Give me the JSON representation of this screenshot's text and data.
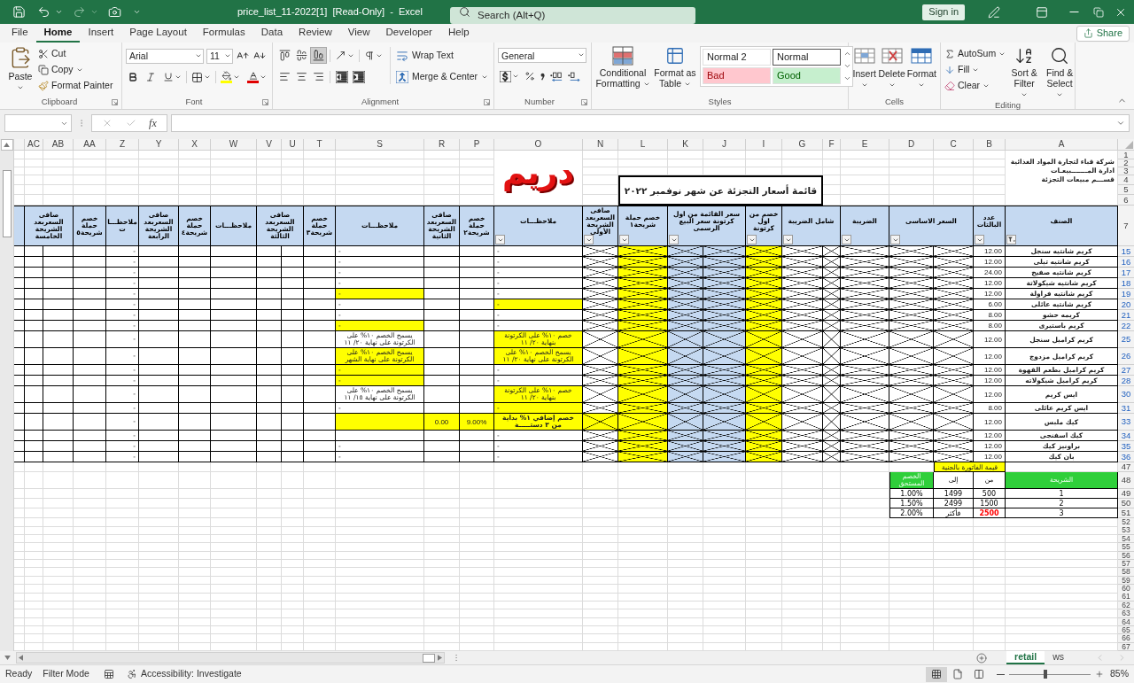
{
  "window": {
    "title": "price_list_11-2022[1]  [Read-Only]  -  Excel",
    "search": {
      "placeholder": "Search (Alt+Q)"
    },
    "sign_in": "Sign in"
  },
  "menu_tabs": [
    {
      "label": "Help",
      "selected": false
    },
    {
      "label": "Developer",
      "selected": false
    },
    {
      "label": "View",
      "selected": false
    },
    {
      "label": "Review",
      "selected": false
    },
    {
      "label": "Data",
      "selected": false
    },
    {
      "label": "Formulas",
      "selected": false
    },
    {
      "label": "Page Layout",
      "selected": false
    },
    {
      "label": "Insert",
      "selected": false
    },
    {
      "label": "Home",
      "selected": true
    },
    {
      "label": "File",
      "selected": false
    }
  ],
  "share": "Share",
  "ribbon": {
    "clipboard": {
      "label": "Clipboard",
      "paste": "Paste",
      "cut": "Cut",
      "copy": "Copy",
      "format_painter": "Format Painter"
    },
    "font": {
      "label": "Font",
      "name": "Arial",
      "size": "11"
    },
    "alignment": {
      "label": "Alignment",
      "vertical_align": [
        {
          "selected": false
        },
        {
          "selected": false
        },
        {
          "selected": true
        }
      ],
      "wrap_text": "Wrap Text",
      "merge_center": "Merge & Center"
    },
    "number": {
      "label": "Number",
      "format": "General"
    },
    "styles": {
      "label": "Styles",
      "conditional_formatting": "Conditional Formatting",
      "format_as_table": "Format as Table",
      "cell_styles": [
        {
          "name": "Normal",
          "kind": "normal",
          "selected": true
        },
        {
          "name": "Normal 2",
          "kind": "normal",
          "selected": false
        },
        {
          "name": "Good",
          "kind": "good",
          "selected": false
        },
        {
          "name": "Bad",
          "kind": "bad",
          "selected": false
        }
      ]
    },
    "cells": {
      "label": "Cells",
      "insert": "Insert",
      "delete": "Delete",
      "format": "Format"
    },
    "editing": {
      "label": "Editing",
      "autosum": "AutoSum",
      "fill": "Fill",
      "clear": "Clear",
      "sort_filter": "Sort & Filter",
      "find_select": "Find & Select"
    }
  },
  "formula_bar": {
    "function_label": "fx"
  },
  "sheet": {
    "column_letters": [
      "A",
      "B",
      "C",
      "D",
      "E",
      "F",
      "G",
      "I",
      "J",
      "K",
      "L",
      "N",
      "O",
      "P",
      "R",
      "S",
      "T",
      "U",
      "V",
      "W",
      "X",
      "Y",
      "Z",
      "AA",
      "AB",
      "AC"
    ],
    "top_row_numbers": [
      "1",
      "2",
      "3",
      "4",
      "5",
      "6"
    ],
    "company_lines": [
      "شركة قباء لتجارة المواد الغذائية",
      "ادارة المـــــــبيعـات",
      "قســـم مبيعات التجزئة"
    ],
    "logo": "دريم",
    "title": "قائمة أسعار التجزئة عن شهر نوفمبر ٢٠٢٢",
    "header": {
      "row_number": "7",
      "cells": [
        {
          "text": "الصنف",
          "merged": false,
          "filter": true,
          "filtered": true
        },
        {
          "text": "عدد البالتات",
          "merged": false,
          "filter": true,
          "filtered": false
        },
        {
          "text": "السعر الاساسى",
          "merged": true,
          "filter": true,
          "filtered": false
        },
        {
          "text": "الضريبة",
          "merged": false,
          "filter": true,
          "filtered": false
        },
        {
          "text": "شامل الضريبة",
          "merged": true,
          "filter": true,
          "filtered": false
        },
        {
          "text": "خصم من اول كرتونة",
          "merged": false,
          "filter": true,
          "filtered": false
        },
        {
          "text": "سعر القائمة من اول كرتونة سعر البيع الرسمى",
          "merged": true,
          "filter": true,
          "filtered": false
        },
        {
          "text": "خصم حملة شريحة١",
          "merged": false,
          "filter": true,
          "filtered": false
        },
        {
          "text": "صافى السعربعد الشريحة الأولى",
          "merged": false,
          "filter": true,
          "filtered": false
        },
        {
          "text": "ملاحظـــات",
          "merged": false,
          "filter": true,
          "filtered": false
        },
        {
          "text": "خصم حملة شريحة٢",
          "merged": false,
          "filter": false
        },
        {
          "text": "صافى السعربعد الشريحة الثانية",
          "merged": false,
          "filter": false
        },
        {
          "text": "ملاحظـــات",
          "merged": false,
          "filter": false
        },
        {
          "text": "خصم حملة شريحة٣",
          "merged": false,
          "filter": false
        },
        {
          "text": "صافى السعربعد الشريحة الثالثة",
          "merged": true,
          "filter": false
        },
        {
          "text": "ملاحظـــات",
          "merged": false,
          "filter": false
        },
        {
          "text": "خصم حملة شريحة٤",
          "merged": false,
          "filter": false
        },
        {
          "text": "صافى السعربعد الشريحة الرابعة",
          "merged": false,
          "filter": false
        },
        {
          "text": "ملاحظـــات",
          "merged": false,
          "filter": false
        },
        {
          "text": "خصم حملة شريحة٥",
          "merged": false,
          "filter": false
        },
        {
          "text": "صافى السعربعد الشريحة الخامسة",
          "merged": true,
          "filter": false
        }
      ]
    },
    "crossed_columns": [
      {
        "color": "#ffffff"
      },
      {
        "color": "#ffffff"
      },
      {
        "color": "#ffffff"
      },
      {
        "color": "#ffffff"
      },
      {
        "color": "#ffffff"
      },
      {
        "color": "#ffff00"
      },
      {
        "color": "#c5d9f1"
      },
      {
        "color": "#c5d9f1"
      },
      {
        "color": "#ffff00"
      },
      {
        "color": "#ffffff"
      }
    ],
    "rows": [
      {
        "row_number": "15",
        "product": "كريم شانتيه سنجل",
        "pallets": "12.00",
        "highlighted": false,
        "notes": [
          {
            "text": "-",
            "highlighted": false,
            "bold": false
          },
          {
            "text": "-",
            "highlighted": false,
            "bold": false
          },
          {
            "text": "-",
            "highlighted": false,
            "bold": false
          }
        ]
      },
      {
        "row_number": "16",
        "product": "كريم شانتيه تيلى",
        "pallets": "12.00",
        "highlighted": false,
        "notes": [
          {
            "text": "-",
            "highlighted": false,
            "bold": false
          },
          {
            "text": "-",
            "highlighted": false,
            "bold": false
          },
          {
            "text": "-",
            "highlighted": false,
            "bold": false
          }
        ]
      },
      {
        "row_number": "17",
        "product": "كريم شانتيه صفيح",
        "pallets": "24.00",
        "highlighted": false,
        "notes": [
          {
            "text": "-",
            "highlighted": false,
            "bold": false
          },
          {
            "text": "-",
            "highlighted": false,
            "bold": false
          },
          {
            "text": "-",
            "highlighted": false,
            "bold": false
          }
        ]
      },
      {
        "row_number": "18",
        "product": "كريم شانتيه شيكولاتة",
        "pallets": "12.00",
        "highlighted": false,
        "notes": [
          {
            "text": "-",
            "highlighted": false,
            "bold": false
          },
          {
            "text": "-",
            "highlighted": false,
            "bold": false
          },
          {
            "text": "-",
            "highlighted": false,
            "bold": false
          }
        ]
      },
      {
        "row_number": "19",
        "product": "كريم شانتيه فراولة",
        "pallets": "12.00",
        "highlighted": false,
        "notes": [
          {
            "text": "-",
            "highlighted": false,
            "bold": false
          },
          {
            "text": "-",
            "highlighted": true,
            "bold": false
          },
          {
            "text": "-",
            "highlighted": false,
            "bold": false
          }
        ]
      },
      {
        "row_number": "20",
        "product": "كريم شانتيه عائلى",
        "pallets": "6.00",
        "highlighted": false,
        "notes": [
          {
            "text": "-",
            "highlighted": true,
            "bold": false
          },
          {
            "text": "-",
            "highlighted": false,
            "bold": false
          },
          {
            "text": "-",
            "highlighted": false,
            "bold": false
          }
        ]
      },
      {
        "row_number": "21",
        "product": "كريمه حشو",
        "pallets": "8.00",
        "highlighted": false,
        "notes": [
          {
            "text": "-",
            "highlighted": false,
            "bold": false
          },
          {
            "text": "-",
            "highlighted": false,
            "bold": false
          },
          {
            "text": "-",
            "highlighted": false,
            "bold": false
          }
        ]
      },
      {
        "row_number": "22",
        "product": "كريم باستيرى",
        "pallets": "8.00",
        "highlighted": false,
        "notes": [
          {
            "text": "-",
            "highlighted": false,
            "bold": false
          },
          {
            "text": "-",
            "highlighted": true,
            "bold": false
          },
          {
            "text": "-",
            "highlighted": false,
            "bold": false
          }
        ]
      },
      {
        "row_number": "25",
        "product": "كريم كراميل سنجل",
        "pallets": "12.00",
        "highlighted": false,
        "notes": [
          {
            "text": "خصم ١٠% على الكرتونة بنهاية ٢٠/ ١١",
            "highlighted": true,
            "bold": false
          },
          {
            "text": "يسمح الخصم ١٠% على الكرتونة على نهاية ٢٠/ ١١",
            "highlighted": false,
            "bold": false
          },
          {
            "text": "-",
            "highlighted": false,
            "bold": false
          }
        ]
      },
      {
        "row_number": "26",
        "product": "كريم كراميل مزدوج",
        "pallets": "12.00",
        "highlighted": false,
        "notes": [
          {
            "text": "يسمح الخصم ١٠% على الكرتونة على نهاية ٢٠/ ١١",
            "highlighted": true,
            "bold": false
          },
          {
            "text": "يسمح الخصم ١٠% على الكرتونة على نهاية الشهر",
            "highlighted": true,
            "bold": false
          },
          {
            "text": "-",
            "highlighted": false,
            "bold": false
          }
        ]
      },
      {
        "row_number": "27",
        "product": "كريم كراميل بطعم القهوة",
        "pallets": "12.00",
        "highlighted": false,
        "notes": [
          {
            "text": "-",
            "highlighted": false,
            "bold": false
          },
          {
            "text": "-",
            "highlighted": true,
            "bold": false
          },
          {
            "text": "-",
            "highlighted": false,
            "bold": false
          }
        ]
      },
      {
        "row_number": "28",
        "product": "كريم كراميل شيكولاته",
        "pallets": "12.00",
        "highlighted": false,
        "notes": [
          {
            "text": "-",
            "highlighted": false,
            "bold": false
          },
          {
            "text": "-",
            "highlighted": true,
            "bold": false
          },
          {
            "text": "-",
            "highlighted": false,
            "bold": false
          }
        ]
      },
      {
        "row_number": "30",
        "product": "ايس كريم",
        "pallets": "12.00",
        "highlighted": false,
        "notes": [
          {
            "text": "خصم ١٠% على الكرتونة بنهاية ٢٠/ ١١",
            "highlighted": true,
            "bold": false
          },
          {
            "text": "يسمح الخصم ١٠% على الكرتونة على نهاية ١٥/ ١١",
            "highlighted": false,
            "bold": false
          },
          {
            "text": "-",
            "highlighted": false,
            "bold": false
          }
        ]
      },
      {
        "row_number": "31",
        "product": "ايس كريم عائلى",
        "pallets": "8.00",
        "highlighted": false,
        "notes": [
          {
            "text": "-",
            "highlighted": true,
            "bold": false
          },
          {
            "text": "-",
            "highlighted": false,
            "bold": false
          },
          {
            "text": "-",
            "highlighted": false,
            "bold": false
          }
        ]
      },
      {
        "row_number": "33",
        "product": "كيك ملبس",
        "pallets": "12.00",
        "highlighted": true,
        "discount_2": "9.00%",
        "net_2": "0.00",
        "notes": [
          {
            "text": "خصم إضافي ١% بداية من ٣ دستـــــة",
            "highlighted": true,
            "bold": true
          },
          {
            "highlighted": true
          },
          {
            "text": "-",
            "highlighted": false,
            "bold": false
          }
        ]
      },
      {
        "row_number": "34",
        "product": "كيك اسفنجى",
        "pallets": "12.00",
        "highlighted": false,
        "notes": [
          {
            "text": "-",
            "highlighted": false,
            "bold": false
          },
          {
            "highlighted": false
          },
          {
            "text": "-",
            "highlighted": false,
            "bold": false
          }
        ]
      },
      {
        "row_number": "35",
        "product": "براونيز كيك",
        "pallets": "12.00",
        "highlighted": false,
        "notes": [
          {
            "text": "-",
            "highlighted": false,
            "bold": false
          },
          {
            "text": "-",
            "highlighted": false,
            "bold": false
          },
          {
            "text": "-",
            "highlighted": false,
            "bold": false
          }
        ]
      },
      {
        "row_number": "36",
        "product": "بان كيك",
        "pallets": "12.00",
        "highlighted": false,
        "notes": [
          {
            "text": "-",
            "highlighted": false,
            "bold": false
          },
          {
            "text": "-",
            "highlighted": false,
            "bold": false
          },
          {
            "text": "-",
            "highlighted": false,
            "bold": false
          }
        ]
      }
    ],
    "discount_table": {
      "caption_row_number": "47",
      "caption": "قيمة الفاتورة بالجنية",
      "header_row_number": "48",
      "headers": [
        {
          "text": "الشريحة",
          "highlighted": true
        },
        {
          "text": "من",
          "highlighted": false
        },
        {
          "text": "إلى",
          "highlighted": false
        },
        {
          "text": "الخصم المستحق",
          "highlighted": true
        }
      ],
      "rows": [
        {
          "row_number": "49",
          "cells": [
            {
              "text": "1",
              "flagged": false
            },
            {
              "text": "500",
              "flagged": false
            },
            {
              "text": "1499",
              "flagged": false
            },
            {
              "text": "1.00%",
              "flagged": false
            }
          ]
        },
        {
          "row_number": "50",
          "cells": [
            {
              "text": "2",
              "flagged": false
            },
            {
              "text": "1500",
              "flagged": false
            },
            {
              "text": "2499",
              "flagged": false
            },
            {
              "text": "1.50%",
              "flagged": false
            }
          ]
        },
        {
          "row_number": "51",
          "cells": [
            {
              "text": "3",
              "flagged": false
            },
            {
              "text": "2500",
              "flagged": true
            },
            {
              "text": "فأكثر",
              "flagged": false
            },
            {
              "text": "2.00%",
              "flagged": false
            }
          ]
        }
      ]
    },
    "empty_row_numbers": [
      "52",
      "53",
      "54",
      "55",
      "56",
      "57",
      "58",
      "59",
      "60",
      "61",
      "62",
      "63",
      "64",
      "65",
      "66",
      "67"
    ]
  },
  "sheet_tabs": [
    {
      "label": "ws",
      "selected": false
    },
    {
      "label": "retail",
      "selected": true
    }
  ],
  "status_bar": {
    "mode": "Ready",
    "filter": "Filter Mode",
    "accessibility": "Accessibility: Investigate",
    "views": [
      {
        "selected": true
      },
      {
        "selected": false
      },
      {
        "selected": false
      }
    ],
    "zoom": {
      "level": 0.45,
      "reading": "85%"
    }
  }
}
